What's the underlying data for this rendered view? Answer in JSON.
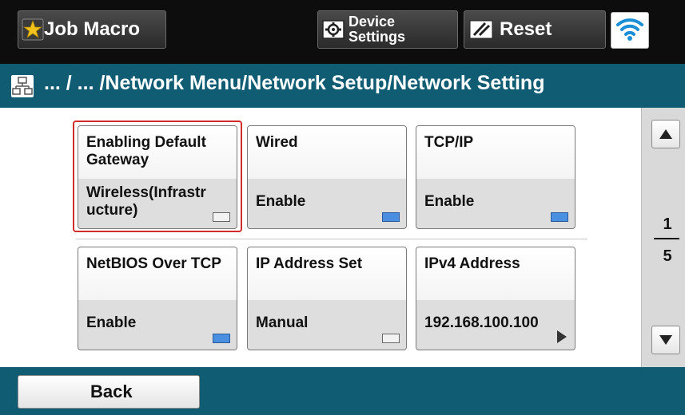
{
  "toolbar": {
    "job_macro_label": "Job Macro",
    "device_settings_line1": "Device",
    "device_settings_line2": "Settings",
    "reset_label": "Reset",
    "icons": [
      "star-icon",
      "device-settings-icon",
      "reset-icon",
      "wifi-icon"
    ]
  },
  "breadcrumb": {
    "path": "... / ... /Network Menu/Network Setup/Network Setting",
    "icon": "network-icon"
  },
  "tiles": [
    {
      "title": "Enabling Default Gateway",
      "value": "Wireless(Infrastr ucture)",
      "indicator": "off",
      "selected": true
    },
    {
      "title": "Wired",
      "value": "Enable",
      "indicator": "on",
      "selected": false
    },
    {
      "title": "TCP/IP",
      "value": "Enable",
      "indicator": "on",
      "selected": false
    },
    {
      "title": "NetBIOS Over TCP",
      "value": "Enable",
      "indicator": "on",
      "selected": false
    },
    {
      "title": "IP Address Set",
      "value": "Manual",
      "indicator": "off",
      "selected": false
    },
    {
      "title": "IPv4 Address",
      "value": "192.168.100.100",
      "indicator": "arrow",
      "selected": false
    }
  ],
  "pager": {
    "current": "1",
    "total": "5"
  },
  "footer": {
    "back_label": "Back"
  },
  "colors": {
    "toolbar_bg": "#0d0d0d",
    "header_bg": "#0f5c73",
    "selection_outline": "#d22b2b",
    "indicator_on": "#4a8fe0"
  }
}
